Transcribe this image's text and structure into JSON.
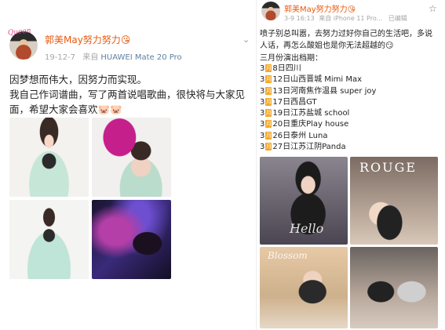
{
  "left_post": {
    "author": "郭美May努力努力",
    "avatar_text": "Queen",
    "timestamp": "19-12-7",
    "source_prefix": "来自",
    "device": "HUAWEI Mate 20 Pro",
    "body_line1": "因梦想而伟大，因努力而实现。",
    "body_line2": "我自己作词谱曲，写了两首说唱歌曲，很快将与大家见面，希望大家会喜欢",
    "emoji": "🐷🐷",
    "author_emoji": "😘"
  },
  "right_post": {
    "author": "郭美May努力努力",
    "author_emoji": "😘",
    "timestamp": "3-9 16:13",
    "source_prefix": "来自",
    "device": "iPhone 11 Pro...",
    "edited": "已编辑",
    "body": "喷子别总叫嚣，去努力过好你自己的生活吧，多说人话，再怎么酸姐也是你无法超越的",
    "body_emoji": "😏",
    "schedule_title": "三月份演出档期：",
    "calendar_label": "月",
    "schedule": [
      {
        "month": "3",
        "day_text": "8日四川"
      },
      {
        "month": "3",
        "day_text": "12日山西晋城 Mimi Max"
      },
      {
        "month": "3",
        "day_text": "13日河南焦作温县 super joy"
      },
      {
        "month": "3",
        "day_text": "17日西昌GT"
      },
      {
        "month": "3",
        "day_text": "19日江苏盐城 school"
      },
      {
        "month": "3",
        "day_text": "20日重庆Play house"
      },
      {
        "month": "3",
        "day_text": "26日泰州 Luna"
      },
      {
        "month": "3",
        "day_text": "27日江苏江阴Panda"
      }
    ],
    "photo_texts": {
      "p1_script": "Hello",
      "p2_title": "ROUGE",
      "p3_script": "Blossom"
    }
  },
  "icons": {
    "chevron": "chevron-down-icon",
    "star": "star-icon"
  },
  "colors": {
    "author": "#e8590c",
    "meta": "#a6a6a6",
    "device": "#5f7fa6",
    "calendar": "#f5a623"
  }
}
